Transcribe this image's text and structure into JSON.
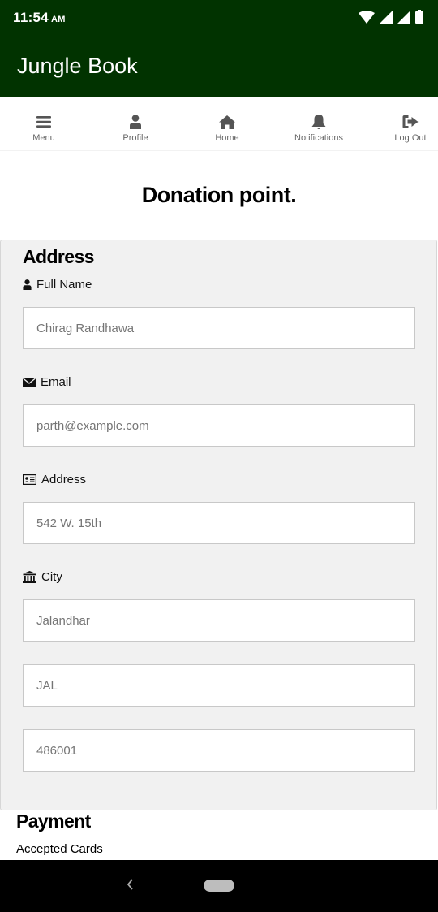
{
  "status_bar": {
    "time": "11:54",
    "ampm": "AM"
  },
  "app_bar": {
    "title": "Jungle Book"
  },
  "nav": [
    {
      "label": "Menu",
      "icon": "menu-icon"
    },
    {
      "label": "Profile",
      "icon": "user-icon"
    },
    {
      "label": "Home",
      "icon": "home-icon"
    },
    {
      "label": "Notifications",
      "icon": "bell-icon"
    },
    {
      "label": "Log Out",
      "icon": "sign-out-icon"
    }
  ],
  "page": {
    "title": "Donation point."
  },
  "address": {
    "heading": "Address",
    "full_name": {
      "label": "Full Name",
      "placeholder": "Chirag Randhawa"
    },
    "email": {
      "label": "Email",
      "placeholder": "parth@example.com"
    },
    "street": {
      "label": "Address",
      "placeholder": "542 W. 15th"
    },
    "city": {
      "label": "City",
      "placeholder": "Jalandhar"
    },
    "state": {
      "placeholder": "JAL"
    },
    "zip": {
      "placeholder": "486001"
    }
  },
  "payment": {
    "heading": "Payment",
    "accepted_cards_label": "Accepted Cards"
  },
  "colors": {
    "app_bar": "#013300",
    "panel": "#f1f1f1",
    "nav_icon": "#555555"
  }
}
